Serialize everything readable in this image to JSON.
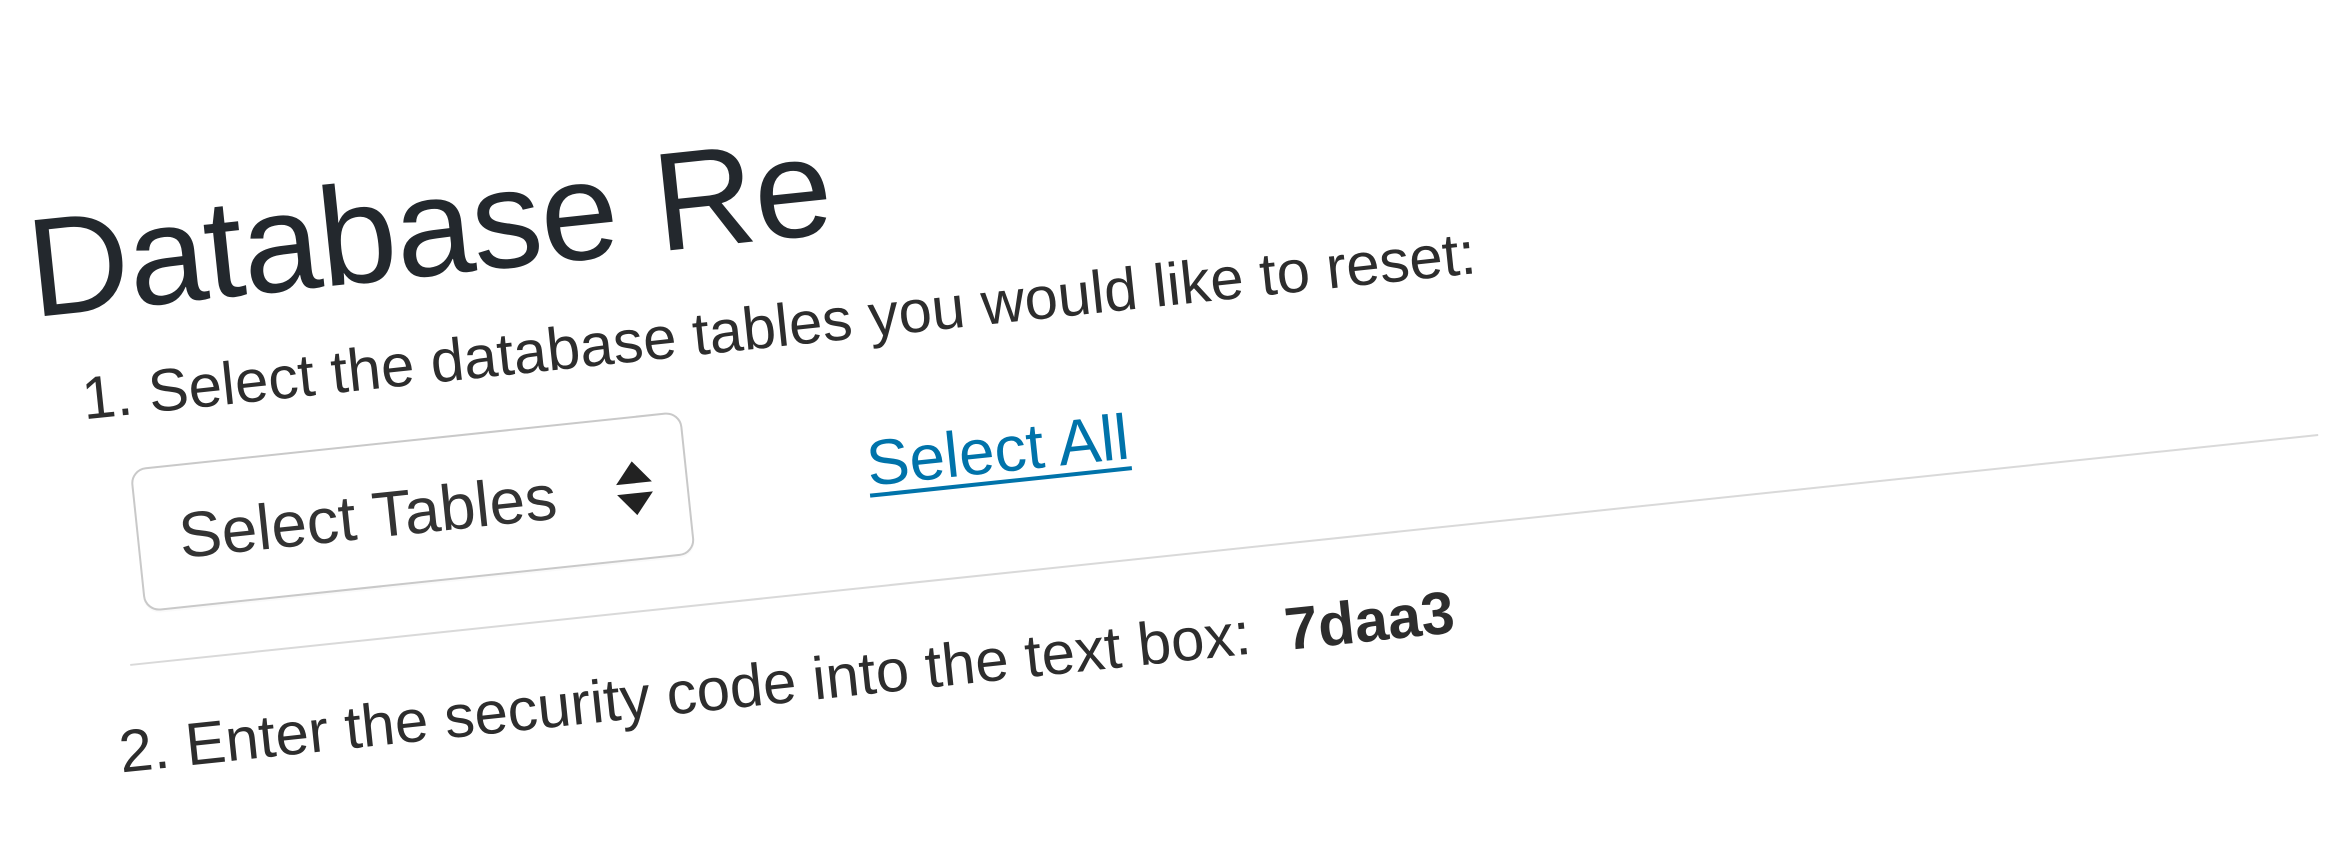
{
  "title": "Database Re",
  "steps": {
    "one": {
      "number": "1.",
      "text": "Select the database tables you would like to reset:"
    },
    "two": {
      "number": "2.",
      "text_prefix": "Enter the security code into the text box:",
      "code": "7daa3"
    }
  },
  "select": {
    "placeholder": "Select Tables"
  },
  "links": {
    "select_all": "Select All"
  }
}
